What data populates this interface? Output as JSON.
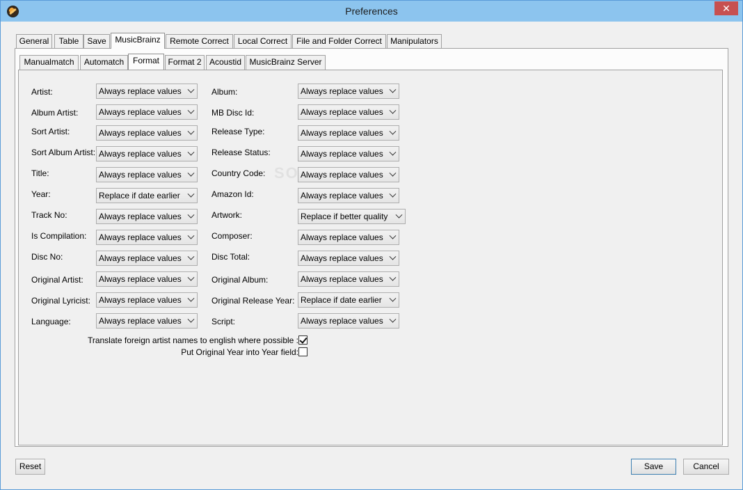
{
  "window": {
    "title": "Preferences",
    "close_symbol": "✕"
  },
  "tabs": [
    {
      "label": "General"
    },
    {
      "label": "Table"
    },
    {
      "label": "Save"
    },
    {
      "label": "MusicBrainz"
    },
    {
      "label": "Remote Correct"
    },
    {
      "label": "Local Correct"
    },
    {
      "label": "File and Folder Correct"
    },
    {
      "label": "Manipulators"
    }
  ],
  "subtabs": [
    {
      "label": "Manualmatch"
    },
    {
      "label": "Automatch"
    },
    {
      "label": "Format"
    },
    {
      "label": "Format 2"
    },
    {
      "label": "Acoustid"
    },
    {
      "label": "MusicBrainz Server"
    }
  ],
  "left_fields": [
    {
      "label": "Artist:",
      "value": "Always replace values"
    },
    {
      "label": "Album Artist:",
      "value": "Always replace values"
    },
    {
      "label": "Sort Artist:",
      "value": "Always replace values"
    },
    {
      "label": "Sort Album Artist:",
      "value": "Always replace values"
    },
    {
      "label": "Title:",
      "value": "Always replace values"
    },
    {
      "label": "Year:",
      "value": "Replace if date earlier"
    },
    {
      "label": "Track No:",
      "value": "Always replace values"
    },
    {
      "label": "Is Compilation:",
      "value": "Always replace values"
    },
    {
      "label": "Disc No:",
      "value": "Always replace values"
    },
    {
      "label": "Original Artist:",
      "value": "Always replace values"
    },
    {
      "label": "Original Lyricist:",
      "value": "Always replace values"
    },
    {
      "label": "Language:",
      "value": "Always replace values"
    }
  ],
  "right_fields": [
    {
      "label": "Album:",
      "value": "Always replace values"
    },
    {
      "label": "MB Disc Id:",
      "value": "Always replace values"
    },
    {
      "label": "Release Type:",
      "value": "Always replace values"
    },
    {
      "label": "Release Status:",
      "value": "Always replace values"
    },
    {
      "label": "Country Code:",
      "value": "Always replace values"
    },
    {
      "label": "Amazon Id:",
      "value": "Always replace values"
    },
    {
      "label": "Artwork:",
      "value": "Replace if better quality"
    },
    {
      "label": "Composer:",
      "value": "Always replace values"
    },
    {
      "label": "Disc Total:",
      "value": "Always replace values"
    },
    {
      "label": "Original Album:",
      "value": "Always replace values"
    },
    {
      "label": "Original Release Year:",
      "value": "Replace if date earlier"
    },
    {
      "label": "Script:",
      "value": "Always replace values"
    }
  ],
  "options": {
    "translate_label": "Translate foreign artist names to english where possible :",
    "original_year_label": "Put Original Year into Year field:"
  },
  "buttons": {
    "reset": "Reset",
    "save": "Save",
    "cancel": "Cancel"
  }
}
